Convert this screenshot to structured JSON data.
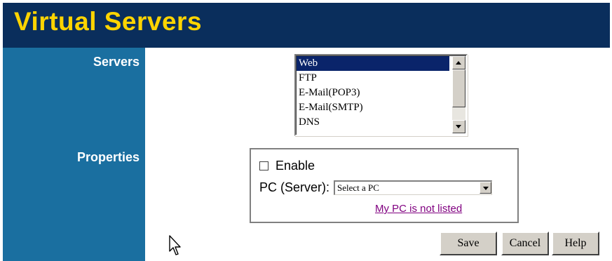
{
  "header": {
    "title": "Virtual Servers"
  },
  "sidebar": {
    "servers_label": "Servers",
    "properties_label": "Properties"
  },
  "servers": {
    "items": [
      "Web",
      "FTP",
      "E-Mail(POP3)",
      "E-Mail(SMTP)",
      "DNS"
    ],
    "selected": "Web"
  },
  "properties": {
    "enable_label": "Enable",
    "enable_checked": false,
    "pc_label": "PC (Server):",
    "pc_selected": "Select a PC",
    "link_text": "My PC is not listed"
  },
  "buttons": {
    "save": "Save",
    "cancel": "Cancel",
    "help": "Help"
  },
  "colors": {
    "header_bg": "#0a2e5c",
    "title": "#ffd400",
    "sidebar_bg": "#1a6fa0",
    "selection": "#0a246a",
    "link": "#800080"
  }
}
